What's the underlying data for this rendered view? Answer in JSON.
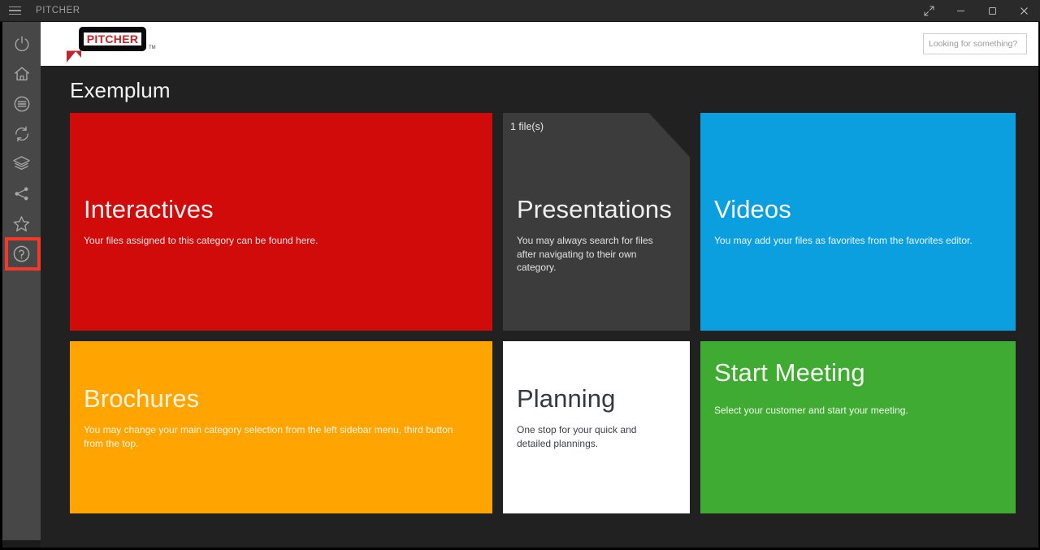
{
  "titlebar": {
    "menu_icon": "hamburger-icon",
    "app_name": "PITCHER",
    "controls": [
      {
        "name": "fullscreen-button",
        "icon": "expand-diagonal-icon"
      },
      {
        "name": "minimize-button",
        "icon": "minus-icon"
      },
      {
        "name": "maximize-button",
        "icon": "square-icon"
      },
      {
        "name": "close-button",
        "icon": "close-x-icon"
      }
    ]
  },
  "sidebar": {
    "items": [
      {
        "name": "power-button",
        "icon": "power-icon",
        "highlighted": false
      },
      {
        "name": "home-button",
        "icon": "home-icon",
        "highlighted": false
      },
      {
        "name": "categories-button",
        "icon": "list-circle-icon",
        "highlighted": false
      },
      {
        "name": "sync-button",
        "icon": "refresh-icon",
        "highlighted": false
      },
      {
        "name": "library-button",
        "icon": "layers-icon",
        "highlighted": false
      },
      {
        "name": "share-button",
        "icon": "share-icon",
        "highlighted": false
      },
      {
        "name": "favorites-button",
        "icon": "star-icon",
        "highlighted": false
      },
      {
        "name": "help-button",
        "icon": "question-circle-icon",
        "highlighted": true
      }
    ]
  },
  "header": {
    "logo": {
      "wordmark": "PITCHER",
      "trademark": "TM",
      "brand_color": "#cf2026"
    },
    "search": {
      "placeholder": "Looking for something?",
      "value": ""
    }
  },
  "main": {
    "page_title": "Exemplum",
    "tiles": [
      {
        "key": "interactives",
        "title": "Interactives",
        "description": "Your files assigned to this category can be found here.",
        "color": "#d10a0a"
      },
      {
        "key": "presentations",
        "title": "Presentations",
        "description": "You may always search for files after navigating to their own category.",
        "color": "#3c3c3c",
        "file_count_label": "1 file(s)",
        "badge_count": "1"
      },
      {
        "key": "videos",
        "title": "Videos",
        "description": "You may add your files as favorites from the favorites editor.",
        "color": "#0c9fe0"
      },
      {
        "key": "brochures",
        "title": "Brochures",
        "description": "You may change your main category selection from the left sidebar menu, third button from the top.",
        "color": "#ffa400"
      },
      {
        "key": "planning",
        "title": "Planning",
        "description": "One stop for your quick and detailed plannings.",
        "color": "#ffffff"
      },
      {
        "key": "start_meeting",
        "title": "Start Meeting",
        "description": "Select your customer and start your meeting.",
        "color": "#40ab33"
      }
    ]
  }
}
